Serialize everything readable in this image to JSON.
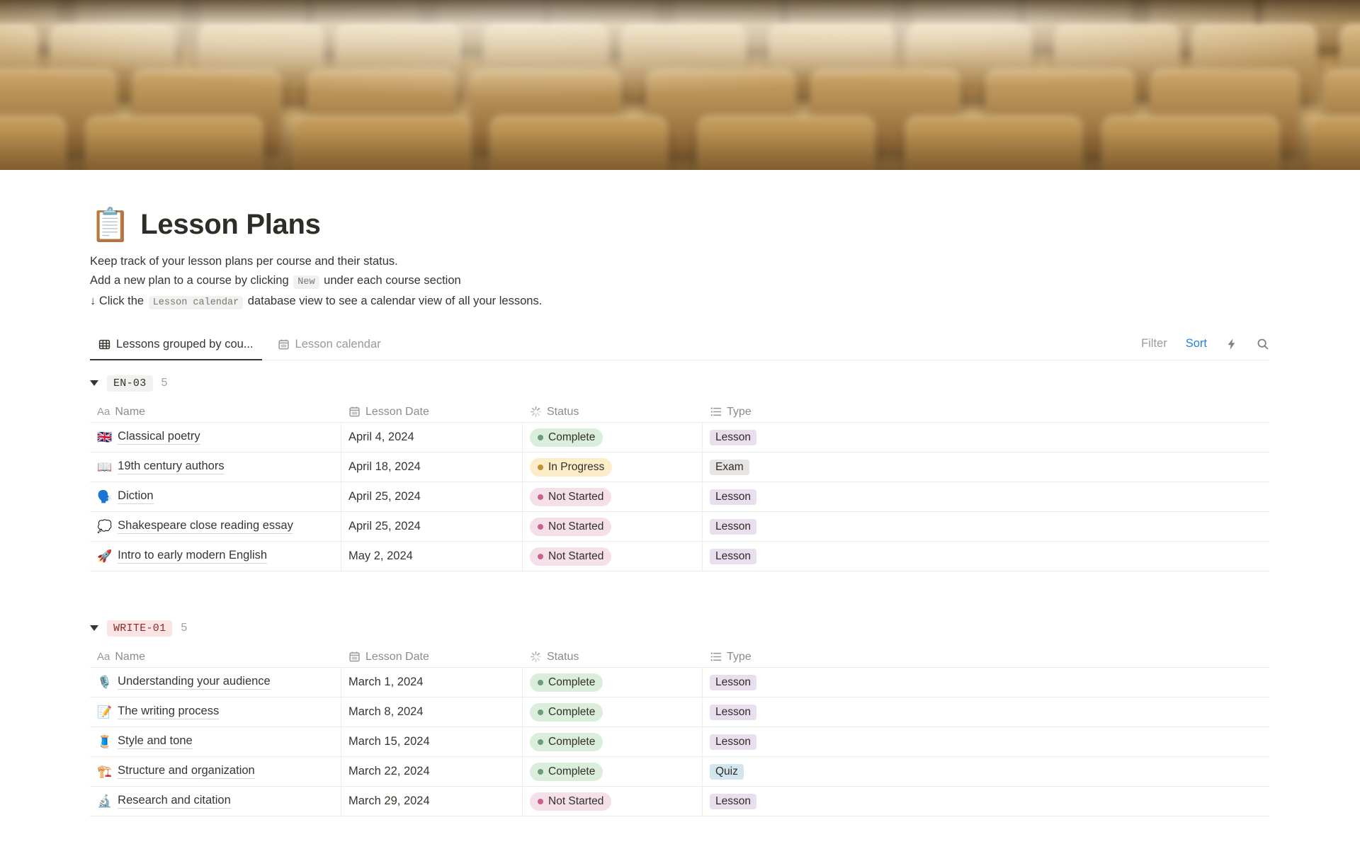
{
  "page": {
    "icon": "📋",
    "title": "Lesson Plans",
    "description_lines": [
      [
        {
          "t": "Keep track of your lesson plans per course and their status."
        }
      ],
      [
        {
          "t": "Add a new plan to a course by clicking "
        },
        {
          "c": "New"
        },
        {
          "t": " under each course section"
        }
      ],
      [
        {
          "t": "↓ Click the "
        },
        {
          "c": "Lesson calendar"
        },
        {
          "t": " database view to see a calendar view of all your lessons."
        }
      ]
    ]
  },
  "toolbar": {
    "tabs": [
      {
        "label": "Lessons grouped by cou...",
        "icon": "table-icon",
        "active": true
      },
      {
        "label": "Lesson calendar",
        "icon": "calendar-icon",
        "active": false
      }
    ],
    "filter_label": "Filter",
    "sort_label": "Sort"
  },
  "table": {
    "columns": [
      {
        "label": "Name",
        "icon": "aa-icon"
      },
      {
        "label": "Lesson Date",
        "icon": "calendar-icon"
      },
      {
        "label": "Status",
        "icon": "status-spinner-icon"
      },
      {
        "label": "Type",
        "icon": "list-icon"
      }
    ]
  },
  "groups": [
    {
      "name": "EN-03",
      "count": "5",
      "chip_bg": "#f1f1ef",
      "chip_color": "#32302c",
      "rows": [
        {
          "emoji": "🇬🇧",
          "name": "Classical poetry",
          "date": "April 4, 2024",
          "status": "Complete",
          "type": "Lesson"
        },
        {
          "emoji": "📖",
          "name": "19th century authors",
          "date": "April 18, 2024",
          "status": "In Progress",
          "type": "Exam"
        },
        {
          "emoji": "🗣️",
          "name": "Diction",
          "date": "April 25, 2024",
          "status": "Not Started",
          "type": "Lesson"
        },
        {
          "emoji": "💭",
          "name": "Shakespeare close reading essay",
          "date": "April 25, 2024",
          "status": "Not Started",
          "type": "Lesson"
        },
        {
          "emoji": "🚀",
          "name": "Intro to early modern English",
          "date": "May 2, 2024",
          "status": "Not Started",
          "type": "Lesson"
        }
      ]
    },
    {
      "name": "WRITE-01",
      "count": "5",
      "chip_bg": "#fbe4e4",
      "chip_color": "#8f2b2b",
      "rows": [
        {
          "emoji": "🎙️",
          "name": "Understanding your audience",
          "date": "March 1, 2024",
          "status": "Complete",
          "type": "Lesson"
        },
        {
          "emoji": "📝",
          "name": "The writing process",
          "date": "March 8, 2024",
          "status": "Complete",
          "type": "Lesson"
        },
        {
          "emoji": "🧵",
          "name": "Style and tone",
          "date": "March 15, 2024",
          "status": "Complete",
          "type": "Lesson"
        },
        {
          "emoji": "🏗️",
          "name": "Structure and organization",
          "date": "March 22, 2024",
          "status": "Complete",
          "type": "Quiz"
        },
        {
          "emoji": "🔬",
          "name": "Research and citation",
          "date": "March 29, 2024",
          "status": "Not Started",
          "type": "Lesson"
        }
      ]
    }
  ],
  "status_styles": {
    "Complete": {
      "bg": "#dbeddb",
      "dot": "#6c9b7d"
    },
    "In Progress": {
      "bg": "#fdecc8",
      "dot": "#c19138"
    },
    "Not Started": {
      "bg": "#f5dfe9",
      "dot": "#c9618f"
    }
  },
  "type_styles": {
    "Lesson": {
      "bg": "#e8deee"
    },
    "Exam": {
      "bg": "#e6e5e2"
    },
    "Quiz": {
      "bg": "#d3e5ef"
    }
  },
  "colors": {
    "accent_blue": "#2383e2",
    "text": "#37352f",
    "muted": "#9b9a97",
    "divider": "#e9e9e7"
  }
}
